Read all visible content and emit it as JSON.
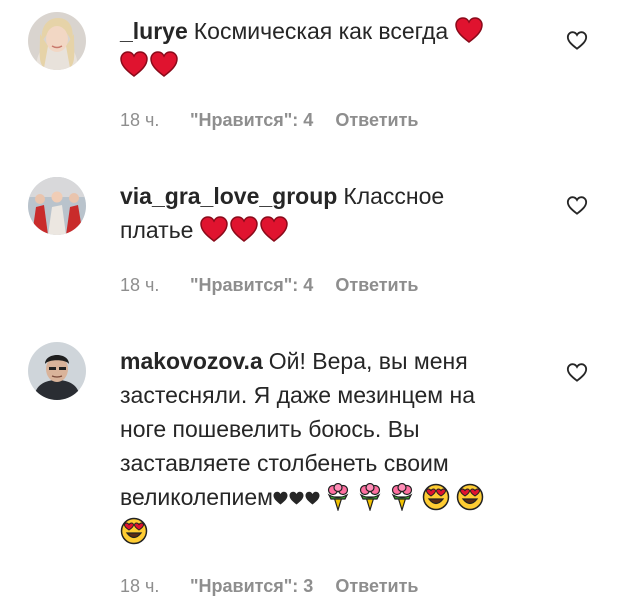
{
  "comments": [
    {
      "username": "_lurye",
      "text": "Космическая как всегда",
      "time": "18 ч.",
      "likes": "\"Нравится\": 4",
      "reply": "Ответить"
    },
    {
      "username": "via_gra_love_group",
      "text": "Классное",
      "text2": "платье",
      "time": "18 ч.",
      "likes": "\"Нравится\": 4",
      "reply": "Ответить"
    },
    {
      "username": "makovozov.a",
      "line1": "Ой! Вера, вы меня",
      "line2": "застесняли. Я даже мезинцем на",
      "line3": "ноге пошевелить боюсь. Вы",
      "line4": "заставляете столбенеть своим",
      "line5": "великолепием",
      "time": "18 ч.",
      "likes": "\"Нравится\": 3",
      "reply": "Ответить"
    }
  ],
  "colors": {
    "text": "#262626",
    "meta": "#8e8e8e",
    "heart_emoji": "#e0132f"
  },
  "icons": {
    "like": "heart-outline-icon",
    "emoji_heart": "red-heart-emoji",
    "emoji_black_heart": "black-heart-emoji",
    "emoji_flowers": "bouquet-emoji",
    "emoji_heart_eyes": "heart-eyes-emoji"
  }
}
